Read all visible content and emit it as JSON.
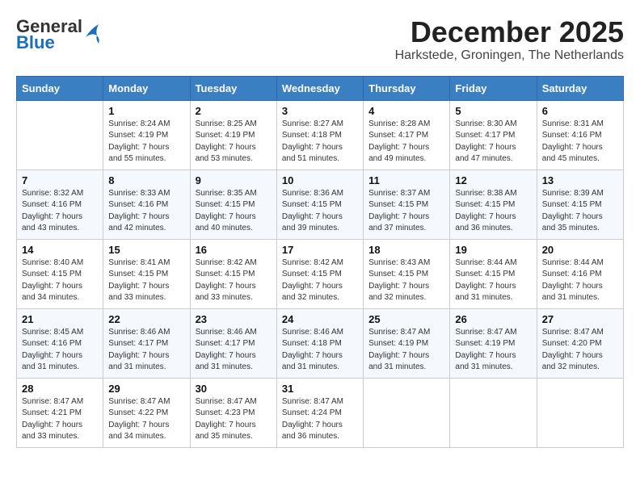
{
  "header": {
    "logo_general": "General",
    "logo_blue": "Blue",
    "month_title": "December 2025",
    "location": "Harkstede, Groningen, The Netherlands"
  },
  "weekdays": [
    "Sunday",
    "Monday",
    "Tuesday",
    "Wednesday",
    "Thursday",
    "Friday",
    "Saturday"
  ],
  "weeks": [
    [
      {
        "day": "",
        "info": ""
      },
      {
        "day": "1",
        "info": "Sunrise: 8:24 AM\nSunset: 4:19 PM\nDaylight: 7 hours\nand 55 minutes."
      },
      {
        "day": "2",
        "info": "Sunrise: 8:25 AM\nSunset: 4:19 PM\nDaylight: 7 hours\nand 53 minutes."
      },
      {
        "day": "3",
        "info": "Sunrise: 8:27 AM\nSunset: 4:18 PM\nDaylight: 7 hours\nand 51 minutes."
      },
      {
        "day": "4",
        "info": "Sunrise: 8:28 AM\nSunset: 4:17 PM\nDaylight: 7 hours\nand 49 minutes."
      },
      {
        "day": "5",
        "info": "Sunrise: 8:30 AM\nSunset: 4:17 PM\nDaylight: 7 hours\nand 47 minutes."
      },
      {
        "day": "6",
        "info": "Sunrise: 8:31 AM\nSunset: 4:16 PM\nDaylight: 7 hours\nand 45 minutes."
      }
    ],
    [
      {
        "day": "7",
        "info": "Sunrise: 8:32 AM\nSunset: 4:16 PM\nDaylight: 7 hours\nand 43 minutes."
      },
      {
        "day": "8",
        "info": "Sunrise: 8:33 AM\nSunset: 4:16 PM\nDaylight: 7 hours\nand 42 minutes."
      },
      {
        "day": "9",
        "info": "Sunrise: 8:35 AM\nSunset: 4:15 PM\nDaylight: 7 hours\nand 40 minutes."
      },
      {
        "day": "10",
        "info": "Sunrise: 8:36 AM\nSunset: 4:15 PM\nDaylight: 7 hours\nand 39 minutes."
      },
      {
        "day": "11",
        "info": "Sunrise: 8:37 AM\nSunset: 4:15 PM\nDaylight: 7 hours\nand 37 minutes."
      },
      {
        "day": "12",
        "info": "Sunrise: 8:38 AM\nSunset: 4:15 PM\nDaylight: 7 hours\nand 36 minutes."
      },
      {
        "day": "13",
        "info": "Sunrise: 8:39 AM\nSunset: 4:15 PM\nDaylight: 7 hours\nand 35 minutes."
      }
    ],
    [
      {
        "day": "14",
        "info": "Sunrise: 8:40 AM\nSunset: 4:15 PM\nDaylight: 7 hours\nand 34 minutes."
      },
      {
        "day": "15",
        "info": "Sunrise: 8:41 AM\nSunset: 4:15 PM\nDaylight: 7 hours\nand 33 minutes."
      },
      {
        "day": "16",
        "info": "Sunrise: 8:42 AM\nSunset: 4:15 PM\nDaylight: 7 hours\nand 33 minutes."
      },
      {
        "day": "17",
        "info": "Sunrise: 8:42 AM\nSunset: 4:15 PM\nDaylight: 7 hours\nand 32 minutes."
      },
      {
        "day": "18",
        "info": "Sunrise: 8:43 AM\nSunset: 4:15 PM\nDaylight: 7 hours\nand 32 minutes."
      },
      {
        "day": "19",
        "info": "Sunrise: 8:44 AM\nSunset: 4:15 PM\nDaylight: 7 hours\nand 31 minutes."
      },
      {
        "day": "20",
        "info": "Sunrise: 8:44 AM\nSunset: 4:16 PM\nDaylight: 7 hours\nand 31 minutes."
      }
    ],
    [
      {
        "day": "21",
        "info": "Sunrise: 8:45 AM\nSunset: 4:16 PM\nDaylight: 7 hours\nand 31 minutes."
      },
      {
        "day": "22",
        "info": "Sunrise: 8:46 AM\nSunset: 4:17 PM\nDaylight: 7 hours\nand 31 minutes."
      },
      {
        "day": "23",
        "info": "Sunrise: 8:46 AM\nSunset: 4:17 PM\nDaylight: 7 hours\nand 31 minutes."
      },
      {
        "day": "24",
        "info": "Sunrise: 8:46 AM\nSunset: 4:18 PM\nDaylight: 7 hours\nand 31 minutes."
      },
      {
        "day": "25",
        "info": "Sunrise: 8:47 AM\nSunset: 4:19 PM\nDaylight: 7 hours\nand 31 minutes."
      },
      {
        "day": "26",
        "info": "Sunrise: 8:47 AM\nSunset: 4:19 PM\nDaylight: 7 hours\nand 31 minutes."
      },
      {
        "day": "27",
        "info": "Sunrise: 8:47 AM\nSunset: 4:20 PM\nDaylight: 7 hours\nand 32 minutes."
      }
    ],
    [
      {
        "day": "28",
        "info": "Sunrise: 8:47 AM\nSunset: 4:21 PM\nDaylight: 7 hours\nand 33 minutes."
      },
      {
        "day": "29",
        "info": "Sunrise: 8:47 AM\nSunset: 4:22 PM\nDaylight: 7 hours\nand 34 minutes."
      },
      {
        "day": "30",
        "info": "Sunrise: 8:47 AM\nSunset: 4:23 PM\nDaylight: 7 hours\nand 35 minutes."
      },
      {
        "day": "31",
        "info": "Sunrise: 8:47 AM\nSunset: 4:24 PM\nDaylight: 7 hours\nand 36 minutes."
      },
      {
        "day": "",
        "info": ""
      },
      {
        "day": "",
        "info": ""
      },
      {
        "day": "",
        "info": ""
      }
    ]
  ]
}
